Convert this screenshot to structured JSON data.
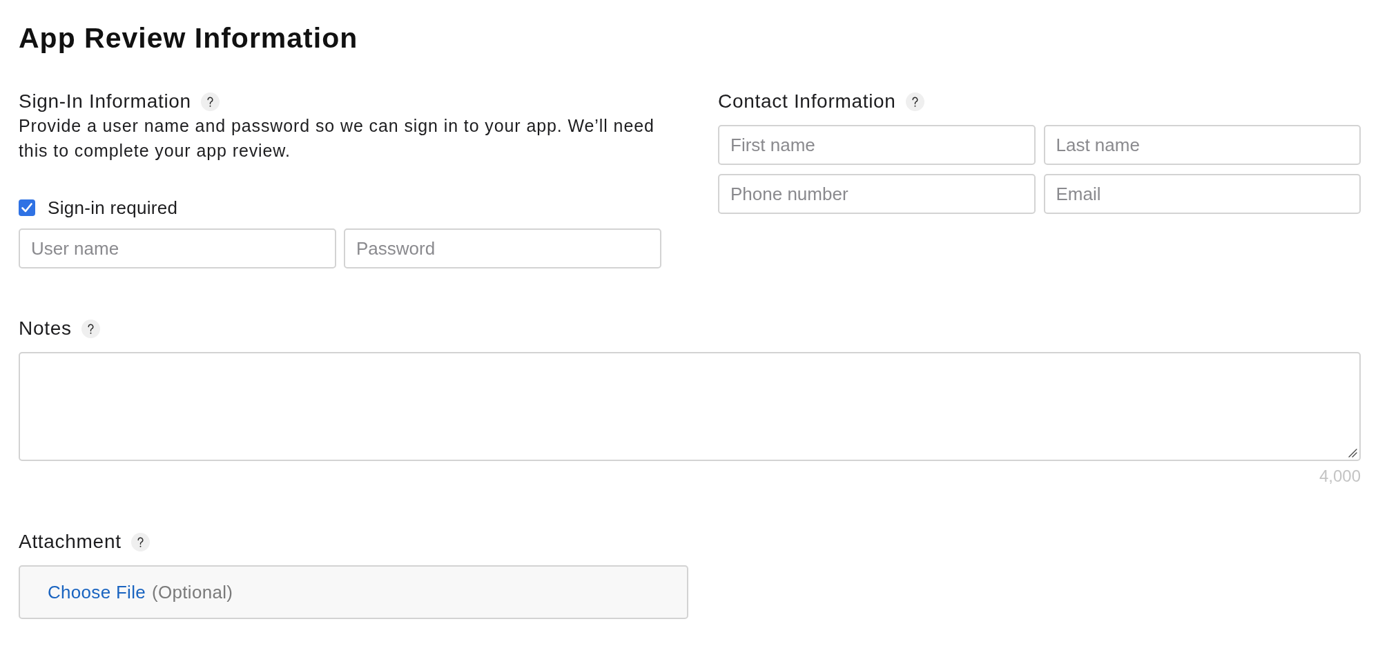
{
  "page": {
    "title": "App Review Information"
  },
  "sign_in": {
    "heading": "Sign-In Information",
    "description": "Provide a user name and password so we can sign in to your app. We’ll need this to complete your app review.",
    "required": {
      "label": "Sign-in required",
      "checked": true
    },
    "fields": [
      {
        "placeholder": "User name"
      },
      {
        "placeholder": "Password"
      }
    ]
  },
  "contact": {
    "heading": "Contact Information",
    "fields": [
      {
        "placeholder": "First name"
      },
      {
        "placeholder": "Last name"
      },
      {
        "placeholder": "Phone number"
      },
      {
        "placeholder": "Email"
      }
    ]
  },
  "notes": {
    "label": "Notes",
    "counter": "4,000"
  },
  "attachment": {
    "label": "Attachment",
    "link": "Choose File",
    "hint": "(Optional)"
  }
}
